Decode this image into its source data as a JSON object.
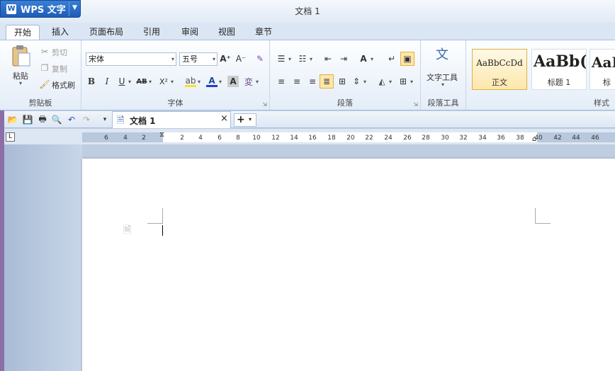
{
  "app": {
    "menu_label": "WPS 文字",
    "logo": "W",
    "title": "文档 1"
  },
  "tabs": [
    "开始",
    "插入",
    "页面布局",
    "引用",
    "审阅",
    "视图",
    "章节"
  ],
  "ribbon": {
    "clipboard": {
      "paste": "粘贴",
      "cut": "剪切",
      "copy": "复制",
      "format_painter": "格式刷",
      "group": "剪贴板"
    },
    "font": {
      "name": "宋体",
      "size": "五号",
      "group": "字体",
      "bold": "B",
      "italic": "I",
      "underline": "U",
      "strike": "AB",
      "superscript": "X²",
      "grow": "A⁺",
      "shrink": "A⁻",
      "phonetic": "変"
    },
    "paragraph": {
      "group": "段落"
    },
    "para_tools": {
      "label": "文字工具",
      "group": "段落工具"
    },
    "styles": {
      "group": "样式",
      "items": [
        {
          "preview": "AaBbCcDd",
          "name": "正文"
        },
        {
          "preview": "AaBb(",
          "name": "标题 1"
        },
        {
          "preview": "AaE",
          "name": "标"
        }
      ]
    }
  },
  "doc_tab": {
    "label": "文档 1",
    "close": "×",
    "new": "+"
  },
  "ruler": {
    "ticks": [
      "6",
      "4",
      "2",
      "2",
      "4",
      "6",
      "8",
      "10",
      "12",
      "14",
      "16",
      "18",
      "20",
      "22",
      "24",
      "26",
      "28",
      "30",
      "32",
      "34",
      "36",
      "38",
      "40",
      "42",
      "44",
      "46"
    ]
  },
  "colors": {
    "accent": "#1e5db7",
    "ribbon": "#e4edf8",
    "highlight": "#fde7ab"
  }
}
